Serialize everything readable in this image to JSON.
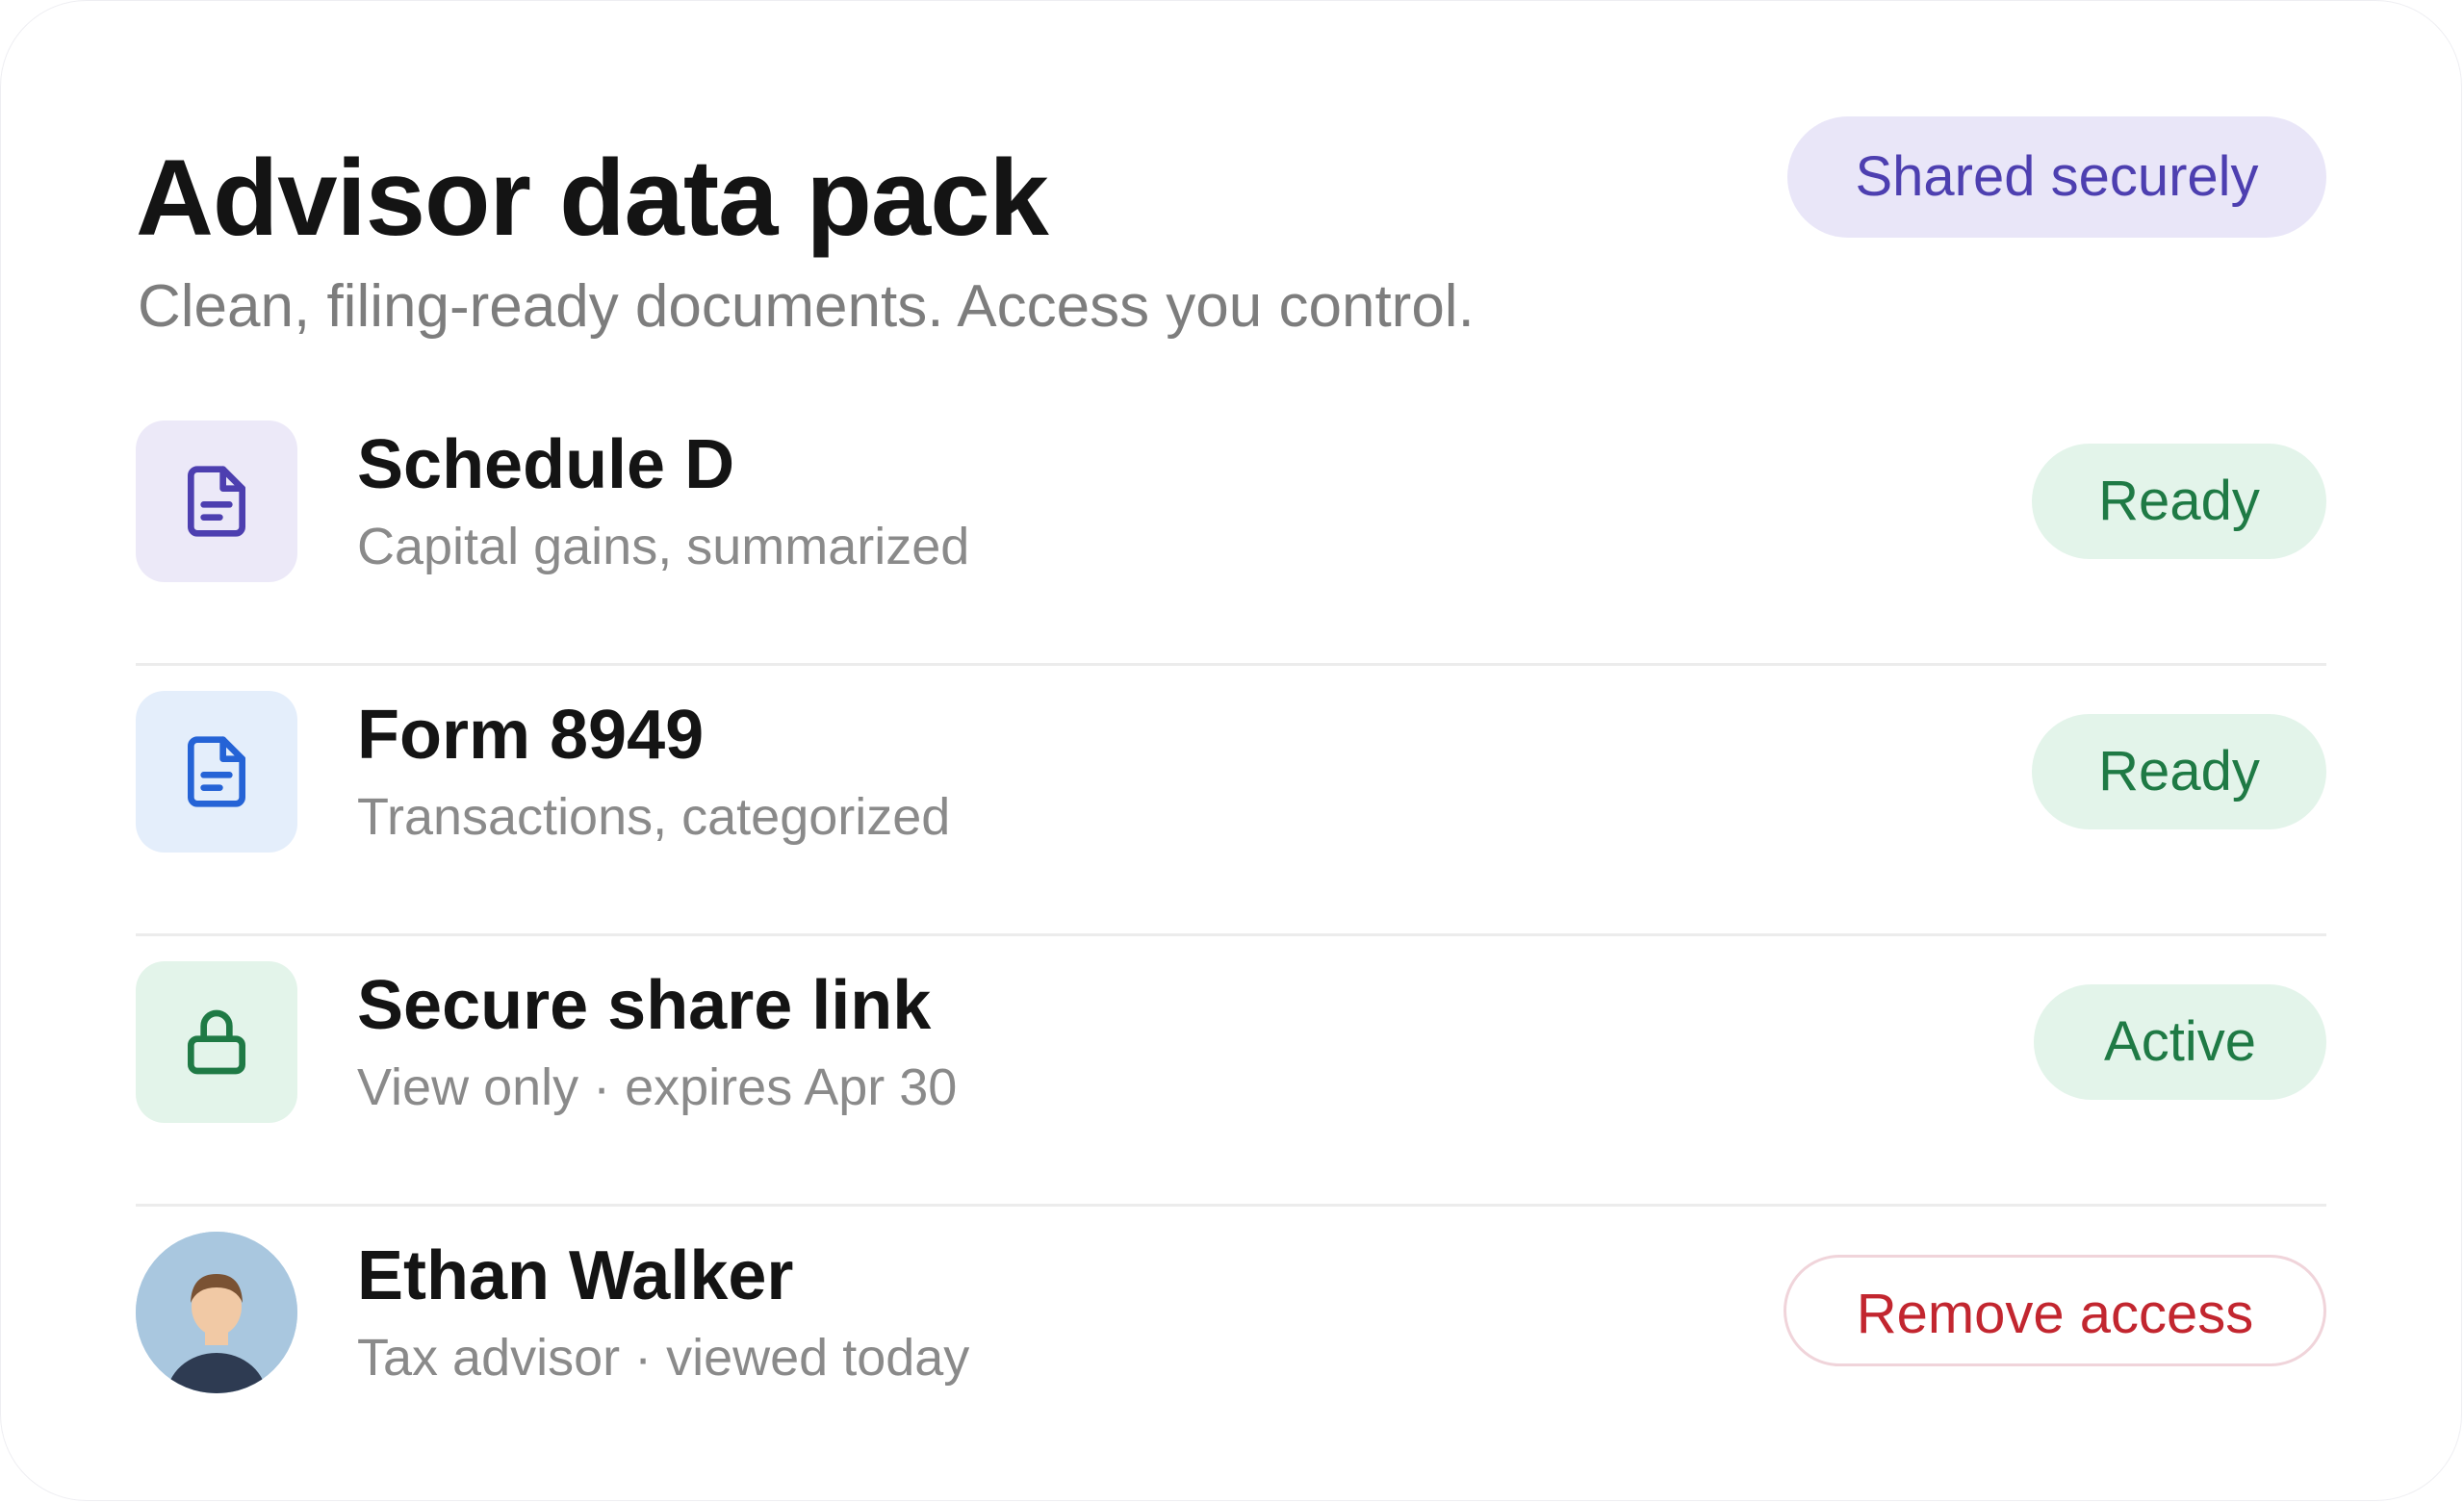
{
  "header": {
    "title": "Advisor data pack",
    "subtitle": "Clean, filing-ready documents. Access you control.",
    "badge": "Shared securely"
  },
  "items": [
    {
      "title": "Schedule D",
      "subtitle": "Capital gains, summarized",
      "status": "Ready",
      "icon": "document-icon",
      "icon_color": "#4d3fb0",
      "icon_bg": "#ece9f8"
    },
    {
      "title": "Form 8949",
      "subtitle": "Transactions, categorized",
      "status": "Ready",
      "icon": "document-icon",
      "icon_color": "#2563d6",
      "icon_bg": "#e4eefb"
    },
    {
      "title": "Secure share link",
      "subtitle": "View only · expires Apr 30",
      "status": "Active",
      "icon": "lock-icon",
      "icon_color": "#1f7a45",
      "icon_bg": "#e3f4ea"
    },
    {
      "title": "Ethan Walker",
      "subtitle": "Tax advisor · viewed today",
      "action": "Remove access",
      "icon": "avatar"
    }
  ],
  "colors": {
    "status_text": "#1f7a45",
    "status_bg": "#e3f4ea",
    "danger": "#c2262f",
    "badge_text": "#4d3fb0",
    "badge_bg": "#e9e6f8"
  }
}
